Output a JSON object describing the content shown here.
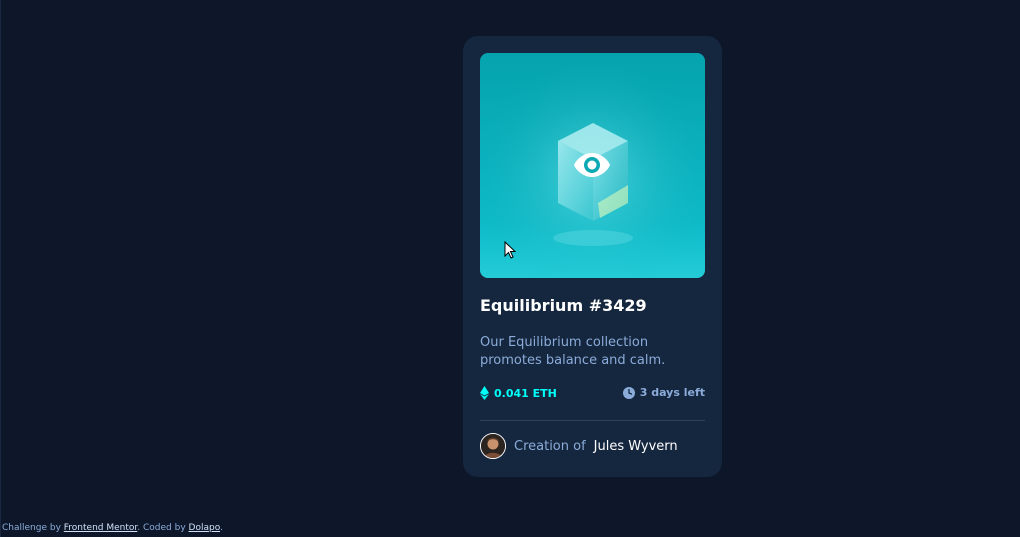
{
  "card": {
    "title": "Equilibrium #3429",
    "description": "Our Equilibrium collection promotes balance and calm.",
    "price": "0.041 ETH",
    "time_left": "3 days left",
    "creator_prefix": "Creation of",
    "creator_name": "Jules Wyvern"
  },
  "attribution": {
    "prefix": "Challenge by",
    "link1": "Frontend Mentor",
    "middle": ". Coded by",
    "link2": "Dolapo",
    "suffix": "."
  },
  "colors": {
    "background": "#0d1729",
    "card": "#15263f",
    "accent_cyan": "#00fff8",
    "soft_blue": "#8bacd9",
    "white": "#ffffff"
  },
  "icons": {
    "price": "ethereum-icon",
    "time": "clock-icon",
    "overlay": "eye-icon"
  }
}
